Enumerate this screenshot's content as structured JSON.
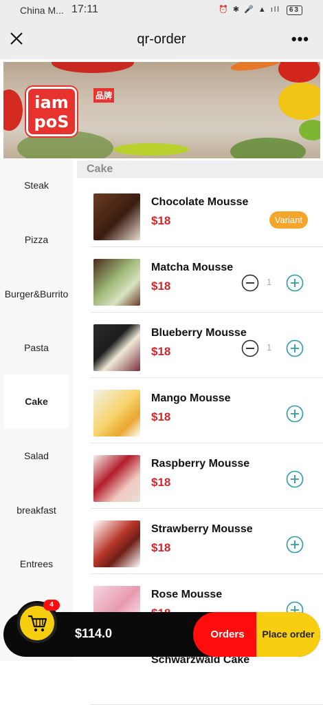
{
  "status_bar": {
    "carrier": "China M...",
    "time": "17:11",
    "icons": "⏰ ✱ 🎤 ▲ ıll",
    "battery": "63"
  },
  "header": {
    "title": "qr-order"
  },
  "banner": {
    "logo_line1": "iam",
    "logo_line2": "poS",
    "brand_badge": "品牌"
  },
  "categories": [
    "Steak",
    "Pizza",
    "Burger&Burrito",
    "Pasta",
    "Cake",
    "Salad",
    "breakfast",
    "Entrees"
  ],
  "active_category": "Cake",
  "section_title": "Cake",
  "products": [
    {
      "name": "Chocolate Mousse",
      "price": "$18",
      "action": "Variant",
      "quantity": ""
    },
    {
      "name": "Matcha Mousse",
      "price": "$18",
      "action": "stepper",
      "quantity": "1"
    },
    {
      "name": "Blueberry Mousse",
      "price": "$18",
      "action": "stepper",
      "quantity": "1"
    },
    {
      "name": "Mango Mousse",
      "price": "$18",
      "action": "add",
      "quantity": ""
    },
    {
      "name": "Raspberry Mousse",
      "price": "$18",
      "action": "add",
      "quantity": ""
    },
    {
      "name": "Strawberry Mousse",
      "price": "$18",
      "action": "add",
      "quantity": ""
    },
    {
      "name": "Rose Mousse",
      "price": "$18",
      "action": "add",
      "quantity": ""
    },
    {
      "name": "Schwarzwald Cake",
      "price": "",
      "action": "",
      "quantity": ""
    }
  ],
  "cart": {
    "count": "4",
    "total": "$114.0",
    "orders_label": "Orders",
    "place_order_label": "Place order"
  },
  "colors": {
    "accent_teal": "#2a9aa3",
    "price_red": "#d3262b",
    "variant_orange": "#f4a62a",
    "cart_yellow": "#f8cf10",
    "orders_red": "#ff0d0d"
  }
}
